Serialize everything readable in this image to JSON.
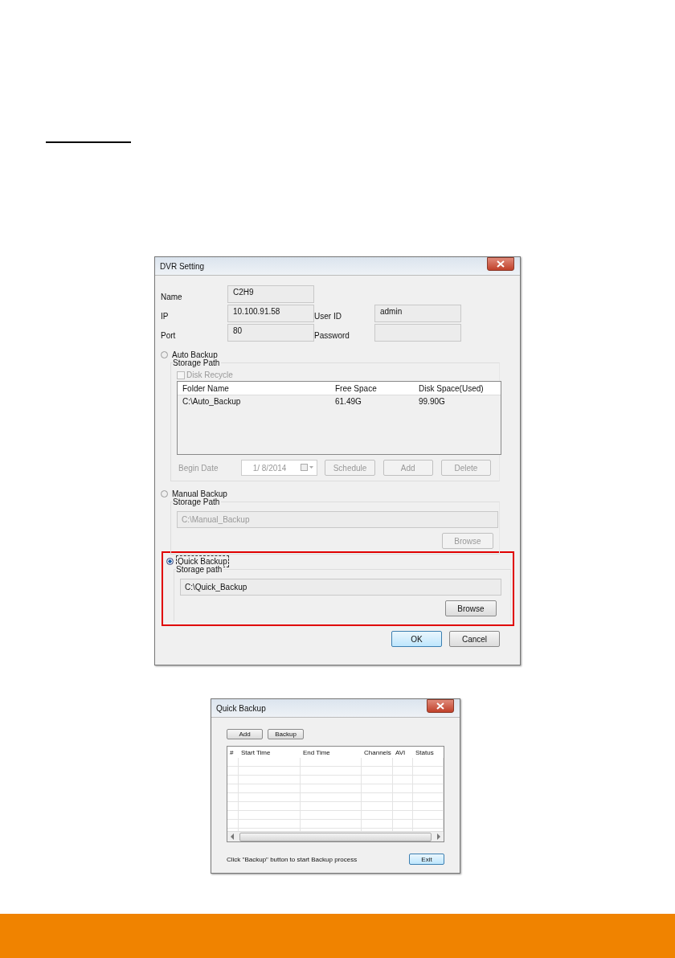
{
  "dvr_dialog": {
    "title": "DVR Setting",
    "field_rows": [
      [
        {
          "label": "Name",
          "value": "C2H9"
        }
      ],
      [
        {
          "label": "IP",
          "value": "10.100.91.58"
        },
        {
          "label": "User ID",
          "value": "admin"
        }
      ],
      [
        {
          "label": "Port",
          "value": "80"
        },
        {
          "label": "Password"
        }
      ]
    ],
    "backup_modes": [
      {
        "kind": "auto",
        "label": "Auto Backup",
        "selected": false,
        "disabled": true,
        "group_label": "Storage Path",
        "disk_recycle": {
          "label": "Disk Recycle",
          "checked": false
        },
        "table": {
          "columns": [
            "Folder Name",
            "Free Space",
            "Disk Space(Used)"
          ],
          "rows": [
            [
              "C:\\Auto_Backup",
              "61.49G",
              "99.90G"
            ]
          ]
        },
        "begin_date": {
          "label": "Begin Date",
          "value": "1/ 8/2014"
        },
        "buttons": [
          "Schedule",
          "Add",
          "Delete"
        ]
      },
      {
        "kind": "manual",
        "label": "Manual Backup",
        "selected": false,
        "disabled": true,
        "group_label": "Storage Path",
        "path": "C:\\Manual_Backup",
        "buttons": [
          "Browse"
        ]
      },
      {
        "kind": "quick",
        "label": "Quick Backup",
        "selected": true,
        "disabled": false,
        "highlighted": true,
        "group_label": "Storage path",
        "path": "C:\\Quick_Backup",
        "buttons": [
          "Browse"
        ]
      }
    ],
    "buttons": [
      {
        "label": "OK",
        "default": true
      },
      {
        "label": "Cancel",
        "default": false
      }
    ]
  },
  "quick_dialog": {
    "title": "Quick Backup",
    "toolbar": [
      "Add",
      "Backup"
    ],
    "table": {
      "columns": [
        "#",
        "Start Time",
        "End Time",
        "Channels",
        "AVI",
        "Status"
      ]
    },
    "hint": "Click \"Backup\" button to start Backup process",
    "buttons": [
      {
        "label": "Exit",
        "default": true
      }
    ]
  }
}
